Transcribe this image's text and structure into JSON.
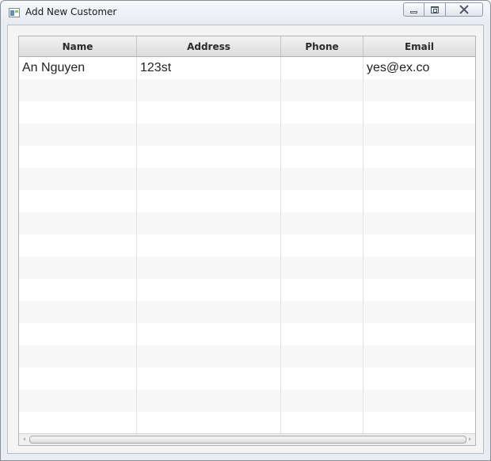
{
  "window": {
    "title": "Add New Customer",
    "icon": "app-window-icon"
  },
  "window_controls": {
    "minimize_icon": "minimize-icon",
    "maximize_icon": "maximize-icon",
    "close_icon": "close-icon"
  },
  "table": {
    "columns": [
      "Name",
      "Address",
      "Phone",
      "Email"
    ],
    "rows": [
      [
        "An Nguyen",
        "123st",
        "",
        "yes@ex.co"
      ]
    ],
    "visible_row_slots": 17
  },
  "scrollbar": {
    "left_arrow": "‹",
    "right_arrow": "›"
  },
  "colors": {
    "header_bg": "#e4e4e4",
    "row_alt": "#f7f7f7",
    "frame": "#e9ecf1"
  }
}
